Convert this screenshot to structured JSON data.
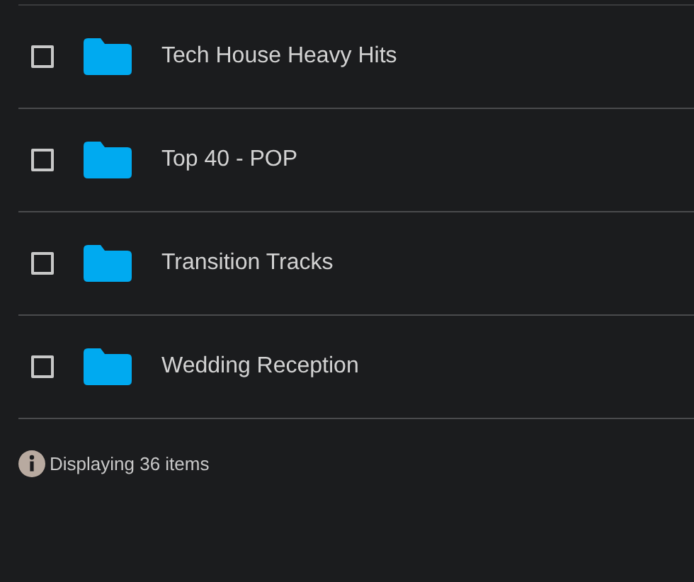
{
  "items": [
    {
      "name": "Tech House Heavy Hits",
      "checked": false
    },
    {
      "name": "Top 40 - POP",
      "checked": false
    },
    {
      "name": "Transition Tracks",
      "checked": false
    },
    {
      "name": "Wedding Reception",
      "checked": false
    }
  ],
  "footer": {
    "text": "Displaying 36 items"
  }
}
